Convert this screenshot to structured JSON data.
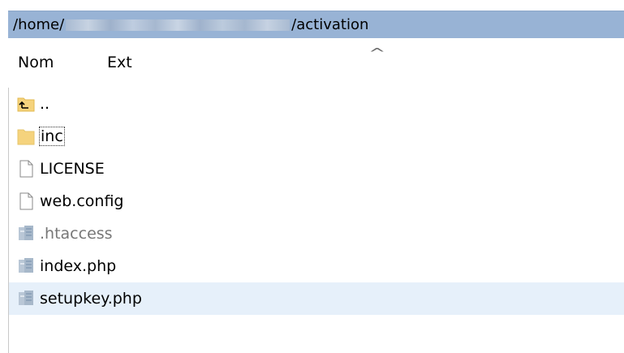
{
  "path": {
    "prefix": "/home/",
    "suffix": "/activation"
  },
  "columns": {
    "name": "Nom",
    "ext": "Ext"
  },
  "files": [
    {
      "label": "..",
      "icon": "parent-folder-icon"
    },
    {
      "label": "inc",
      "icon": "folder-icon"
    },
    {
      "label": "LICENSE",
      "icon": "file-icon"
    },
    {
      "label": "web.config",
      "icon": "file-icon"
    },
    {
      "label": ".htaccess",
      "icon": "script-file-icon"
    },
    {
      "label": "index.php",
      "icon": "script-file-icon"
    },
    {
      "label": "setupkey.php",
      "icon": "script-file-icon"
    }
  ],
  "colors": {
    "path_bar": "#98b3d5",
    "row_highlight": "#e6f0fa",
    "folder": "#f5d37d"
  }
}
